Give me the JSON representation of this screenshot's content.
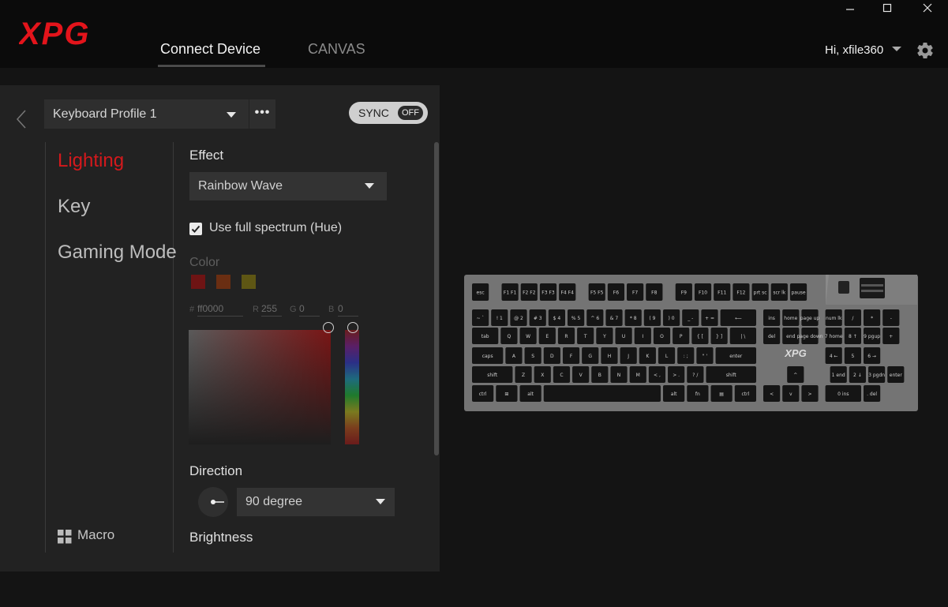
{
  "brand": {
    "logo_text": "XPG",
    "accent": "#e3141b"
  },
  "header": {
    "tabs": [
      {
        "label": "Connect Device",
        "active": true
      },
      {
        "label": "CANVAS",
        "active": false
      }
    ],
    "user_greeting": "Hi, xfile360",
    "window_controls": [
      "minimize-icon",
      "maximize-icon",
      "close-icon"
    ]
  },
  "profile": {
    "selected": "Keyboard Profile 1",
    "more_label": "•••"
  },
  "sync": {
    "label": "SYNC",
    "state": "OFF"
  },
  "nav": {
    "items": [
      {
        "label": "Lighting",
        "active": true
      },
      {
        "label": "Key",
        "active": false
      },
      {
        "label": "Gaming Mode",
        "active": false
      }
    ],
    "macro_label": "Macro"
  },
  "effect": {
    "title": "Effect",
    "selected": "Rainbow Wave",
    "full_spectrum_label": "Use full spectrum (Hue)",
    "full_spectrum_checked": true
  },
  "color": {
    "title": "Color",
    "swatches": [
      "#6e1414",
      "#6a2e12",
      "#5e5614"
    ],
    "hex_label": "#",
    "hex_value": "ff0000",
    "r_label": "R",
    "r_value": "255",
    "g_label": "G",
    "g_value": "0",
    "b_label": "B",
    "b_value": "0"
  },
  "direction": {
    "title": "Direction",
    "selected": "90 degree"
  },
  "brightness": {
    "title": "Brightness"
  },
  "keyboard": {
    "logo_text": "XPG",
    "rows": [
      [
        "esc",
        "",
        "F1 F1",
        "F2 F2",
        "F3 F3",
        "F4 F4",
        "",
        "F5 F5",
        "F6",
        "F7",
        "F8",
        "",
        "F9",
        "F10",
        "F11",
        "F12",
        "prt sc",
        "scr lk",
        "pause"
      ],
      [
        "~ `",
        "! 1",
        "@ 2",
        "# 3",
        "$ 4",
        "% 5",
        "^ 6",
        "& 7",
        "* 8",
        "( 9",
        ") 0",
        "_ -",
        "+ =",
        "⟵",
        "ins",
        "home",
        "page up",
        "num lk",
        "/",
        "*",
        "-"
      ],
      [
        "tab",
        "Q",
        "W",
        "E",
        "R",
        "T",
        "Y",
        "U",
        "I",
        "O",
        "P",
        "{ [",
        "} ]",
        "| \\",
        "del",
        "end",
        "page down",
        "7 home",
        "8 ↑",
        "9 pgup",
        "+"
      ],
      [
        "caps",
        "A",
        "S",
        "D",
        "F",
        "G",
        "H",
        "J",
        "K",
        "L",
        ": ;",
        "\" '",
        "enter",
        "4 ←",
        "5",
        "6 →"
      ],
      [
        "shift",
        "Z",
        "X",
        "C",
        "V",
        "B",
        "N",
        "M",
        "< ,",
        "> .",
        "? /",
        "shift",
        "^",
        "1 end",
        "2 ↓",
        "3 pgdn",
        "enter"
      ],
      [
        "ctrl",
        "⊞",
        "alt",
        "",
        "alt",
        "fn",
        "▤",
        "ctrl",
        "<",
        "v",
        ">",
        "0 ins",
        ". del"
      ]
    ]
  }
}
